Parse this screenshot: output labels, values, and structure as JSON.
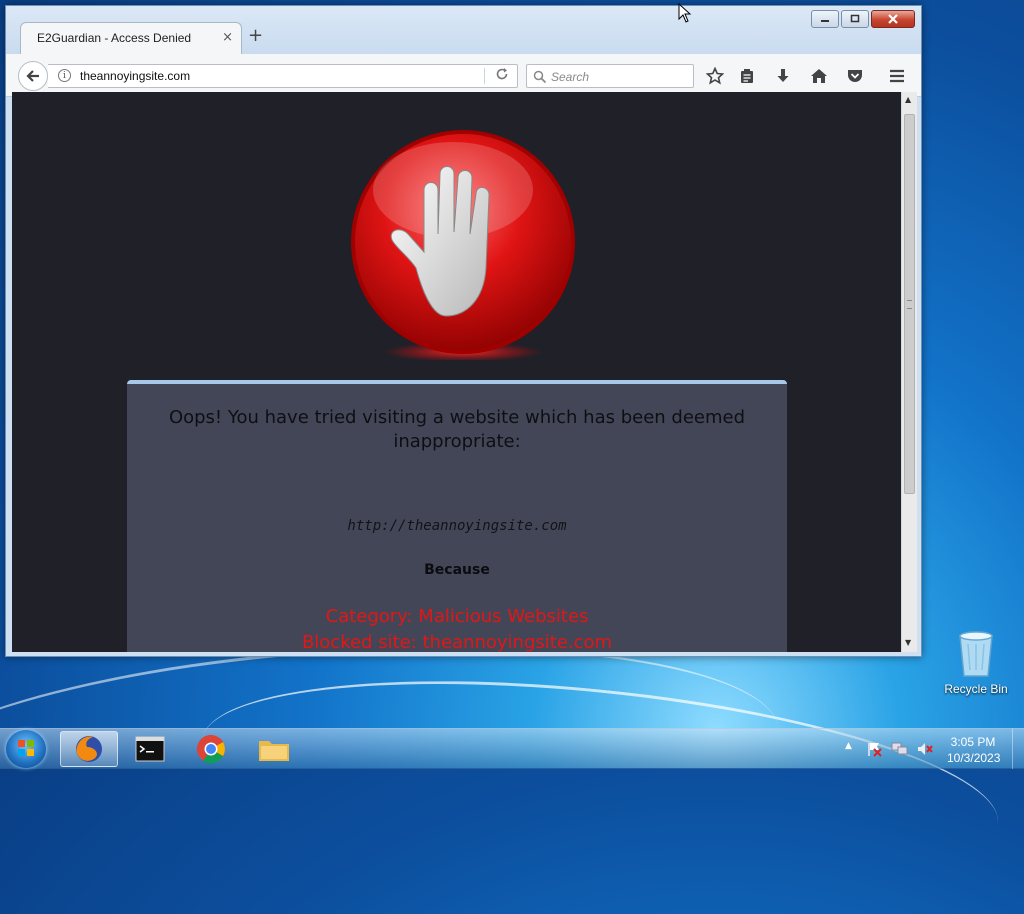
{
  "browser": {
    "tab_title": "E2Guardian - Access Denied",
    "tab_close": "×",
    "new_tab": "+",
    "url": "theannoyingsite.com",
    "search_placeholder": "Search"
  },
  "page": {
    "headline": "Oops! You have tried visiting a website which has been deemed inappropriate:",
    "blocked_url": "http://theannoyingsite.com",
    "because": "Because",
    "category": "Category: Malicious Websites",
    "blocked_site": "Blocked site: theannoyingsite.com"
  },
  "desktop": {
    "recycle_bin": "Recycle Bin"
  },
  "taskbar": {
    "time": "3:05 PM",
    "date": "10/3/2023"
  },
  "icons": [
    "back-arrow-icon",
    "info-icon",
    "reload-icon",
    "search-icon",
    "bookmark-star-icon",
    "reading-list-icon",
    "download-icon",
    "home-icon",
    "pocket-icon",
    "hamburger-menu-icon",
    "stop-hand-icon",
    "recycle-bin-icon",
    "firefox-icon",
    "cmd-icon",
    "chrome-icon",
    "folder-icon",
    "flag-icon",
    "network-icon",
    "volume-muted-icon"
  ]
}
